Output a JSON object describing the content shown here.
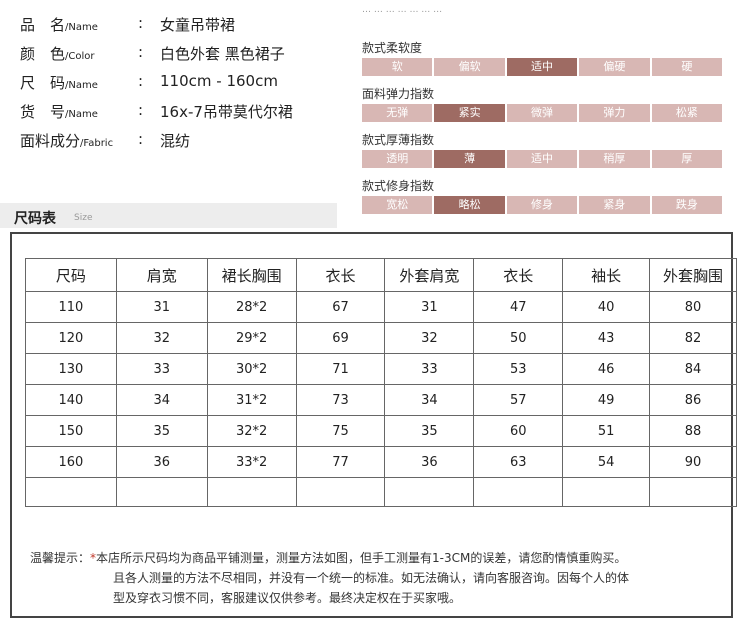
{
  "product_info": [
    {
      "label_cn": "品　名",
      "label_en": "/Name",
      "value": "女童吊带裙"
    },
    {
      "label_cn": "颜　色",
      "label_en": "/Color",
      "value": "白色外套  黑色裙子"
    },
    {
      "label_cn": "尺　码",
      "label_en": "/Name",
      "value": "110cm - 160cm"
    },
    {
      "label_cn": "货　号",
      "label_en": "/Name",
      "value": "16x-7吊带莫代尔裙"
    },
    {
      "label_cn": "面料成分",
      "label_en": "/Fabric",
      "value": "混纺"
    }
  ],
  "colon": ":",
  "faded_text": "… … … … … … …",
  "scales": [
    {
      "title": "款式柔软度",
      "options": [
        "软",
        "偏软",
        "适中",
        "偏硬",
        "硬"
      ],
      "selected": 2
    },
    {
      "title": "面料弹力指数",
      "options": [
        "无弹",
        "紧实",
        "微弹",
        "弹力",
        "松紧"
      ],
      "selected": 1
    },
    {
      "title": "款式厚薄指数",
      "options": [
        "透明",
        "薄",
        "适中",
        "稍厚",
        "厚"
      ],
      "selected": 1
    },
    {
      "title": "款式修身指数",
      "options": [
        "宽松",
        "略松",
        "修身",
        "紧身",
        "跌身"
      ],
      "selected": 1
    }
  ],
  "size_section": {
    "title_cn": "尺码表",
    "title_en": "Size"
  },
  "table": {
    "headers": [
      "尺码",
      "肩宽",
      "裙长胸围",
      "衣长",
      "外套肩宽",
      "衣长",
      "袖长",
      "外套胸围"
    ],
    "rows": [
      [
        "110",
        "31",
        "28*2",
        "67",
        "31",
        "47",
        "40",
        "80"
      ],
      [
        "120",
        "32",
        "29*2",
        "69",
        "32",
        "50",
        "43",
        "82"
      ],
      [
        "130",
        "33",
        "30*2",
        "71",
        "33",
        "53",
        "46",
        "84"
      ],
      [
        "140",
        "34",
        "31*2",
        "73",
        "34",
        "57",
        "49",
        "86"
      ],
      [
        "150",
        "35",
        "32*2",
        "75",
        "35",
        "60",
        "51",
        "88"
      ],
      [
        "160",
        "36",
        "33*2",
        "77",
        "36",
        "63",
        "54",
        "90"
      ]
    ]
  },
  "note": {
    "prefix": "温馨提示：",
    "star": "*",
    "line1": "本店所示尺码均为商品平铺测量，测量方法如图，但手工测量有1-3CM的误差，请您酌情慎重购买。",
    "line2": "且各人测量的方法不尽相同，并没有一个统一的标准。如无法确认，请向客服咨询。因每个人的体",
    "line3": "型及穿衣习惯不同，客服建议仅供参考。最终决定权在于买家哦。"
  }
}
